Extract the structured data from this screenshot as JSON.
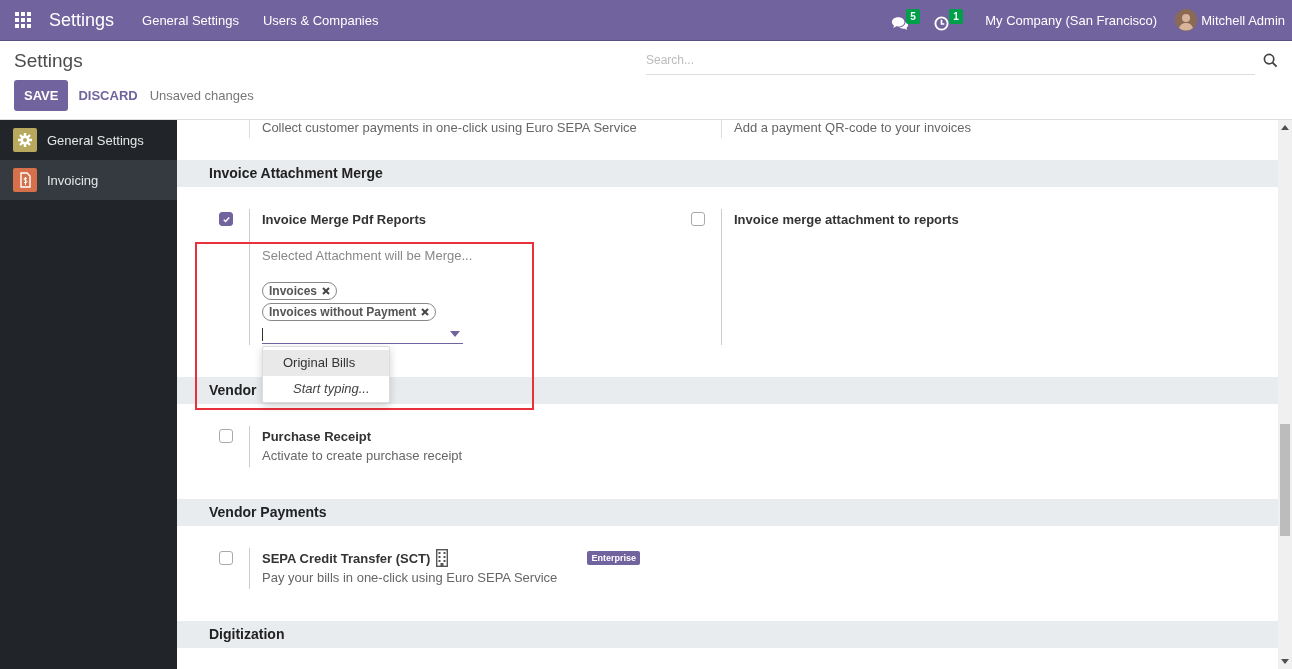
{
  "navbar": {
    "app_title": "Settings",
    "menus": [
      "General Settings",
      "Users & Companies"
    ],
    "messages_count": "5",
    "activities_count": "1",
    "company": "My Company (San Francisco)",
    "user": "Mitchell Admin"
  },
  "control_panel": {
    "title": "Settings",
    "search": {
      "placeholder": "Search..."
    },
    "buttons": [
      {
        "label": "SAVE",
        "kind": "primary"
      },
      {
        "label": "DISCARD",
        "kind": "link"
      }
    ],
    "status": "Unsaved changes"
  },
  "sidebar": {
    "items": [
      {
        "label": "General Settings",
        "selected": false,
        "color": "#b8a95f"
      },
      {
        "label": "Invoicing",
        "selected": true,
        "color": "#d6704a"
      }
    ]
  },
  "partial_settings": [
    {
      "description": "Collect customer payments in one-click using Euro SEPA Service"
    },
    {
      "description": "Add a payment QR-code to your invoices"
    }
  ],
  "sections": [
    {
      "title": "Invoice Attachment Merge",
      "highlighted": true,
      "settings": [
        {
          "label": "Invoice Merge Pdf Reports",
          "checked": true,
          "field": {
            "label": "Selected Attachment will be Merge...",
            "tags": [
              "Invoices",
              "Invoices without Payment"
            ],
            "dropdown": {
              "options": [
                {
                  "label": "Original Bills",
                  "selected": true
                }
              ],
              "hint": "Start typing..."
            }
          }
        },
        {
          "label": "Invoice merge attachment to reports",
          "checked": false
        }
      ]
    },
    {
      "title": "Vendor",
      "settings": [
        {
          "label": "Purchase Receipt",
          "checked": false,
          "description": "Activate to create purchase receipt"
        }
      ]
    },
    {
      "title": "Vendor Payments",
      "settings": [
        {
          "label": "SEPA Credit Transfer (SCT)",
          "checked": false,
          "company_icon": true,
          "badge": "Enterprise",
          "description": "Pay your bills in one-click using Euro SEPA Service"
        }
      ]
    },
    {
      "title": "Digitization"
    }
  ]
}
